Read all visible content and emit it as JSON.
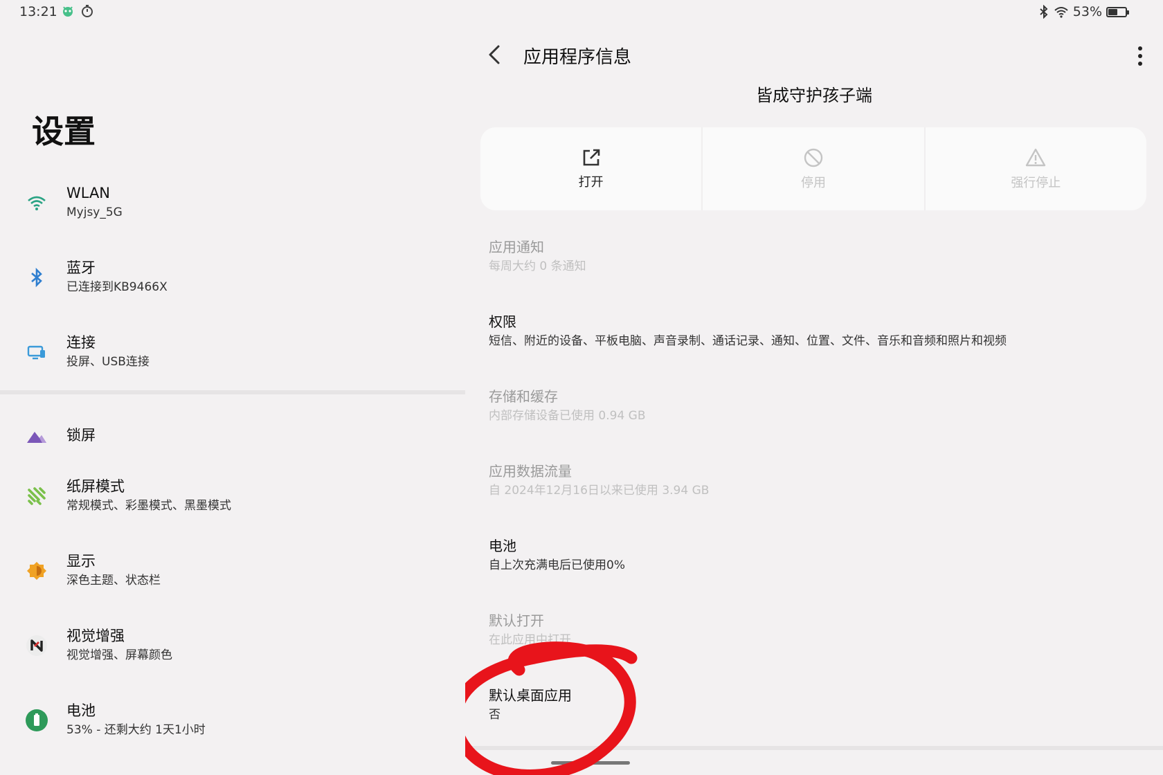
{
  "status_bar": {
    "time": "13:21",
    "battery_text": "53%",
    "battery_level": 0.53,
    "left_icons": [
      "bug-mascot-icon",
      "timer-icon"
    ],
    "right_icons": [
      "bluetooth-icon",
      "wifi-icon",
      "battery-icon"
    ]
  },
  "left_pane": {
    "title": "设置",
    "items": [
      {
        "icon": "wifi-icon",
        "color": "#2aa384",
        "title": "WLAN",
        "subtitle": "Myjsy_5G"
      },
      {
        "icon": "bluetooth-icon",
        "color": "#2f7fd0",
        "title": "蓝牙",
        "subtitle": "已连接到KB9466X"
      },
      {
        "icon": "monitor-icon",
        "color": "#3a9ad9",
        "title": "连接",
        "subtitle": "投屏、USB连接"
      },
      {
        "icon": "mountain-icon",
        "color": "#7b57b8",
        "title": "锁屏",
        "subtitle": ""
      },
      {
        "icon": "paper-mode-icon",
        "color": "#7ac04b",
        "title": "纸屏模式",
        "subtitle": "常规模式、彩墨模式、黑墨模式"
      },
      {
        "icon": "brightness-icon",
        "color": "#f0a224",
        "title": "显示",
        "subtitle": "深色主题、状态栏"
      },
      {
        "icon": "visual-enhance-icon",
        "color": "#d33030",
        "title": "视觉增强",
        "subtitle": "视觉增强、屏幕颜色"
      },
      {
        "icon": "battery-icon",
        "color": "#2e9a5a",
        "title": "电池",
        "subtitle": "53% - 还剩大约 1天1小时"
      }
    ]
  },
  "right_pane": {
    "title": "应用程序信息",
    "app_name": "皆成守护孩子端",
    "actions": [
      {
        "icon": "open-external-icon",
        "label": "打开",
        "enabled": true
      },
      {
        "icon": "disable-icon",
        "label": "停用",
        "enabled": false
      },
      {
        "icon": "warning-icon",
        "label": "强行停止",
        "enabled": false
      }
    ],
    "info": [
      {
        "title": "应用通知",
        "subtitle": "每周大约 0 条通知",
        "enabled": false
      },
      {
        "title": "权限",
        "subtitle": "短信、附近的设备、平板电脑、声音录制、通话记录、通知、位置、文件、音乐和音频和照片和视频",
        "enabled": true
      },
      {
        "title": "存储和缓存",
        "subtitle": "内部存储设备已使用 0.94 GB",
        "enabled": false
      },
      {
        "title": "应用数据流量",
        "subtitle": "自 2024年12月16日以来已使用 3.94 GB",
        "enabled": false
      },
      {
        "title": "电池",
        "subtitle": "自上次充满电后已使用0%",
        "enabled": true
      },
      {
        "title": "默认打开",
        "subtitle": "在此应用中打开",
        "enabled": false
      },
      {
        "title": "默认桌面应用",
        "subtitle": "否",
        "enabled": true
      }
    ]
  },
  "annotation_color": "#e8141b"
}
